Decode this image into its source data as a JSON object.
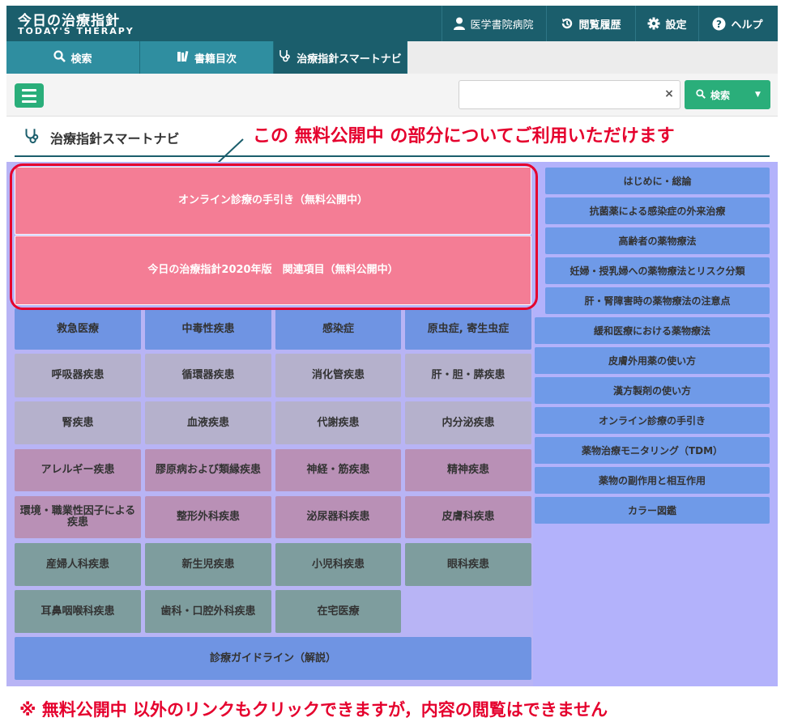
{
  "header": {
    "title": "今日の治療指針",
    "subtitle": "TODAY'S THERAPY",
    "user_label": "医学書院病院",
    "history_label": "閲覧履歴",
    "settings_label": "設定",
    "help_label": "ヘルプ"
  },
  "tabs": {
    "search": "検索",
    "toc": "書籍目次",
    "smart_navi": "治療指針スマートナビ"
  },
  "toolbar": {
    "search_value": "",
    "clear_label": "×",
    "search_button": "検索",
    "caret": "▼"
  },
  "section": {
    "title": "治療指針スマートナビ",
    "callout": "この 無料公開中 の部分についてご利用いただけます"
  },
  "free_items": {
    "online": "オンライン診療の手引き（無料公開中）",
    "related2020": "今日の治療指針2020年版　関連項目（無料公開中）"
  },
  "grid": {
    "r1": [
      "救急医療",
      "中毒性疾患",
      "感染症",
      "原虫症, 寄生虫症"
    ],
    "r2": [
      "呼吸器疾患",
      "循環器疾患",
      "消化管疾患",
      "肝・胆・膵疾患"
    ],
    "r3": [
      "腎疾患",
      "血液疾患",
      "代謝疾患",
      "内分泌疾患"
    ],
    "r4": [
      "アレルギー疾患",
      "膠原病および類縁疾患",
      "神経・筋疾患",
      "精神疾患"
    ],
    "r5": [
      "環境・職業性因子による疾患",
      "整形外科疾患",
      "泌尿器科疾患",
      "皮膚科疾患"
    ],
    "r6": [
      "産婦人科疾患",
      "新生児疾患",
      "小児科疾患",
      "眼科疾患"
    ],
    "r7": [
      "耳鼻咽喉科疾患",
      "歯科・口腔外科疾患",
      "在宅医療"
    ],
    "guideline": "診療ガイドライン（解説）"
  },
  "right_links": [
    "はじめに・総論",
    "抗菌薬による感染症の外来治療",
    "高齢者の薬物療法",
    "妊婦・授乳婦への薬物療法とリスク分類",
    "肝・腎障害時の薬物療法の注意点",
    "緩和医療における薬物療法",
    "皮膚外用薬の使い方",
    "漢方製剤の使い方",
    "オンライン診療の手引き",
    "薬物治療モニタリング（TDM）",
    "薬物の副作用と相互作用",
    "カラー図鑑"
  ],
  "footnote": "※ 無料公開中 以外のリンクもクリックできますが，内容の閲覧はできません",
  "colors": {
    "header": "#1b5e6c",
    "tab": "#2f8ea0",
    "accent_green": "#2aae7a",
    "free_pink": "#f47d95",
    "highlight_red": "#e5002d"
  }
}
